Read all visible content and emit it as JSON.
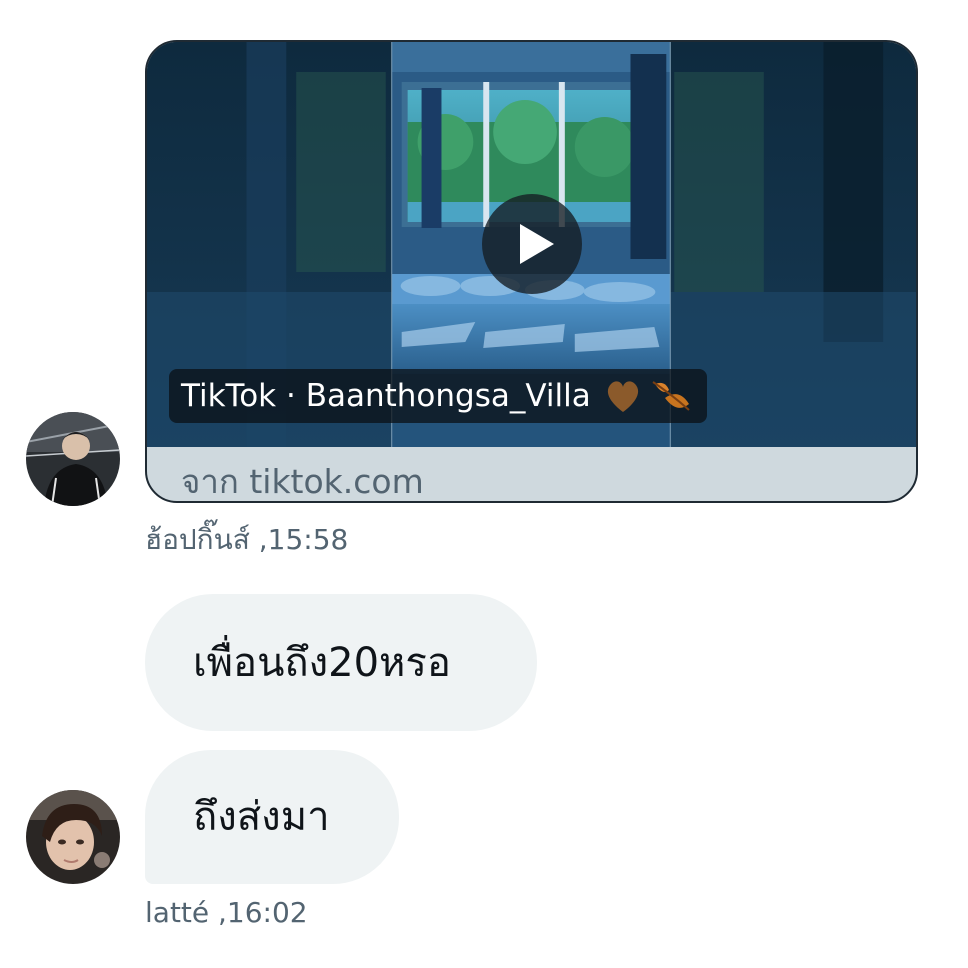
{
  "link_card": {
    "caption_prefix": "TikTok · Baanthongsa_Villa",
    "caption_emoji": "🤎🍂",
    "domain_text": "จาก tiktok.com"
  },
  "messages": [
    {
      "sender": "ฮ้อปกิ๊นส์",
      "time_label": "ฮ้อปกิ๊นส์ ,15:58"
    },
    {
      "text": "เพื่อนถึง20หรอ"
    },
    {
      "text": "ถึงส่งมา",
      "sender": "latté",
      "time_label": "latté ,16:02"
    }
  ],
  "colors": {
    "bubble_bg": "#eff3f4",
    "card_footer_bg": "#cfd9de",
    "meta_text": "#536471"
  },
  "icons": [
    "play-icon",
    "brown-heart-icon",
    "fallen-leaf-icon"
  ]
}
